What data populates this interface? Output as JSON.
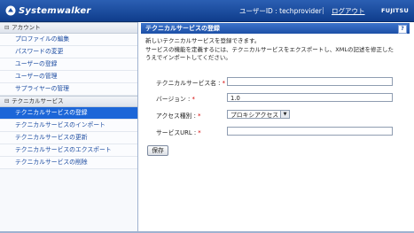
{
  "header": {
    "brand": "Systemwalker",
    "user_id": "ユーザーID : techprovider",
    "separator": "|",
    "logout": "ログアウト",
    "company_logo": "FUJITSU"
  },
  "sidebar": {
    "groups": [
      {
        "title": "アカウント",
        "toggle": "⊟",
        "items": [
          "プロファイルの編集",
          "パスワードの変更",
          "ユーザーの登録",
          "ユーザーの管理",
          "サプライヤーの管理"
        ]
      },
      {
        "title": "テクニカルサービス",
        "toggle": "⊟",
        "items": [
          "テクニカルサービスの登録",
          "テクニカルサービスのインポート",
          "テクニカルサービスの更新",
          "テクニカルサービスのエクスポート",
          "テクニカルサービスの削除"
        ]
      }
    ],
    "active_item": "テクニカルサービスの登録"
  },
  "main": {
    "title": "テクニカルサービスの登録",
    "help": "?",
    "description_line1": "新しいテクニカルサービスを登録できます。",
    "description_line2": "サービスの機能を定義するには、テクニカルサービスをエクスポートし、XMLの記述を修正した",
    "description_line3": "うえでインポートしてください。",
    "form": {
      "service_name_label": "テクニカルサービス名 :",
      "service_name_value": "",
      "version_label": "バージョン :",
      "version_value": "1.0",
      "access_type_label": "アクセス種別 :",
      "access_type_value": "プロキシアクセス",
      "service_url_label": "サービスURL :",
      "service_url_value": "",
      "required_mark": "*"
    },
    "save_button": "保存"
  },
  "colors": {
    "header_blue": "#1c4fa6",
    "active_item": "#1c66d8",
    "link_blue": "#1a4aa0",
    "required_red": "#d40000"
  }
}
